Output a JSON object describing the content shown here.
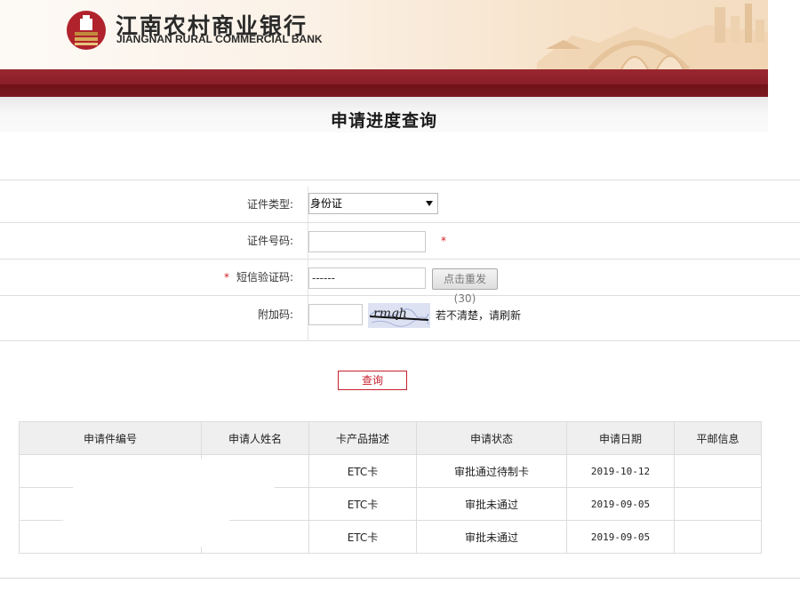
{
  "header": {
    "bank_name_cn": "江南农村商业银行",
    "bank_name_en": "JIANGNAN RURAL COMMERCIAL BANK",
    "logo_icon": "bank-logo-icon",
    "accent_color": "#8a1e28"
  },
  "page": {
    "title": "申请进度查询"
  },
  "form": {
    "id_type": {
      "label": "证件类型:",
      "value": "身份证"
    },
    "id_number": {
      "label": "证件号码:",
      "value": "",
      "required_mark": "*"
    },
    "sms_code": {
      "label": "短信验证码:",
      "required_mark": "*",
      "value": "------",
      "resend_label": "点击重发(30)"
    },
    "extra_code": {
      "label": "附加码:",
      "value": "",
      "captcha_text": "rmqh",
      "refresh_tip": "若不清楚，请刷新"
    }
  },
  "actions": {
    "query_label": "查询"
  },
  "table": {
    "headers": [
      "申请件编号",
      "申请人姓名",
      "卡产品描述",
      "申请状态",
      "申请日期",
      "平邮信息"
    ],
    "rows": [
      {
        "app_no": "",
        "name": "",
        "product": "ETC卡",
        "status": "审批通过待制卡",
        "date": "2019-10-12",
        "mail": ""
      },
      {
        "app_no": "",
        "name": "",
        "product": "ETC卡",
        "status": "审批未通过",
        "date": "2019-09-05",
        "mail": ""
      },
      {
        "app_no": "",
        "name": "",
        "product": "ETC卡",
        "status": "审批未通过",
        "date": "2019-09-05",
        "mail": ""
      }
    ]
  }
}
